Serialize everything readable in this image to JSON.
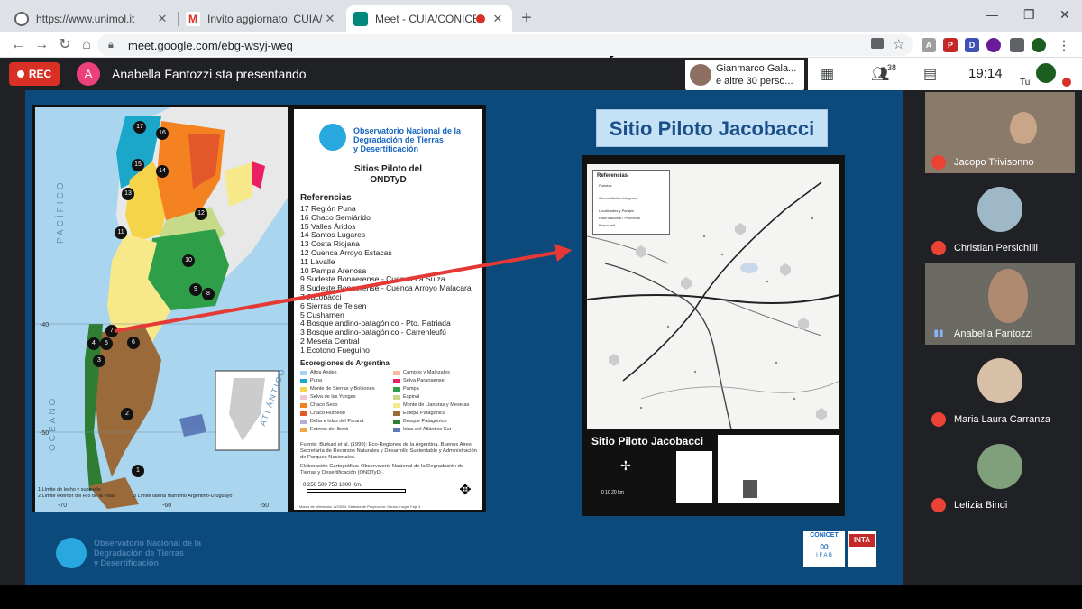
{
  "browser": {
    "tabs": [
      {
        "title": "https://www.unimol.it"
      },
      {
        "title": "Invito aggiornato: CUIA/CONICE"
      },
      {
        "title": "Meet - CUIA/CONICET: WEB"
      }
    ],
    "url": "meet.google.com/ebg-wsyj-weq"
  },
  "meet": {
    "rec_label": "REC",
    "presenter_initial": "A",
    "presenter_text": "Anabella Fantozzi sta presentando",
    "guest_line1": "Gianmarco Gala...",
    "guest_line2": "e altre 30 perso...",
    "participants_count": "38",
    "time": "19:14",
    "self_label": "Tu"
  },
  "slide": {
    "obs_title": [
      "Observatorio Nacional de la",
      "Degradación de Tierras",
      "y Desertificación"
    ],
    "sites_title": [
      "Sitios Piloto del",
      "ONDTyD"
    ],
    "references_title": "Referencias",
    "references": [
      "17 Región Puna",
      "16 Chaco Semiárido",
      "15 Valles Áridos",
      "14 Santos Lugares",
      "13 Costa Riojana",
      "12 Cuenca Arroyo Estacas",
      "11 Lavalle",
      "10 Pampa Arenosa",
      "9 Sudeste Bonaerense - Cuenca La Suiza",
      "8 Sudeste Bonaerense - Cuenca Arroyo Malacara",
      "7 Jacobacci",
      "6 Sierras de Telsen",
      "5 Cushamen",
      "4 Bosque andino-patagónico - Pto. Patriada",
      "3 Bosque andino-patagónico - Carrenleufú",
      "2 Meseta Central",
      "1 Ecotono Fueguino"
    ],
    "ecoregions_title": "Ecoregiones de Argentina",
    "ecoregions_left": [
      {
        "name": "Altos Andes",
        "color": "#9fd3ef"
      },
      {
        "name": "Puna",
        "color": "#1aa7c9"
      },
      {
        "name": "Monte de Sierras y Bolsones",
        "color": "#f5d44a"
      },
      {
        "name": "Selva de las Yungas",
        "color": "#f3c2d8"
      },
      {
        "name": "Chaco Seco",
        "color": "#f58220"
      },
      {
        "name": "Chaco Húmedo",
        "color": "#e2582a"
      },
      {
        "name": "Delta e Islas del Paraná",
        "color": "#b0b0d8"
      },
      {
        "name": "Esteros del Iberá",
        "color": "#f0a84a"
      }
    ],
    "ecoregions_right": [
      {
        "name": "Campos y Malezales",
        "color": "#f6b9a1"
      },
      {
        "name": "Selva Paranaense",
        "color": "#e91e63"
      },
      {
        "name": "Pampa",
        "color": "#2e9e48"
      },
      {
        "name": "Espinal",
        "color": "#c6da8a"
      },
      {
        "name": "Monte de Llanuras y Mesetas",
        "color": "#f7e98a"
      },
      {
        "name": "Estepa Patagónica",
        "color": "#9b6a3a"
      },
      {
        "name": "Bosque Patagónico",
        "color": "#2e7d32"
      },
      {
        "name": "Islas del Atlántico Sur",
        "color": "#5c7ab8"
      }
    ],
    "source": "Fuente: Burkart et al. (1999): Eco-Regiones de la Argentina. Buenos Aires, Secretaría de Recursos Naturales y Desarrollo Sustentable y Administración de Parques Nacionales.",
    "cartography": "Elaboración Cartográfica: Observatorio Nacional de la Degradación de Tierras y Desertificación (ONDTyD).",
    "scale_labels": "0    250    500    750    1000 Km.",
    "map_labels": {
      "pacifico": "PACÍFICO",
      "oceano": "OCEANO",
      "atlantico": "ATLÁNTICO",
      "lat40": "-40",
      "lat50": "-50",
      "lon70": "-70",
      "lon60": "-60",
      "lon50": "-50",
      "limit1": "1 Límite de lecho y subsuelo",
      "limit2": "2 Límite exterior del Río de la Plata",
      "limit3": "3 Límite lateral marítimo Argentino-Uruguayo"
    },
    "marco": "Marco de referencia: WGS84. Sistema de Proyección: Gauss-Kruger Faja 4",
    "pilot_title": "Sitio Piloto Jacobacci",
    "pilot_legend": {
      "title": "Referencias",
      "items": [
        "Puestos",
        "Comunidades Indígenas",
        "Localidades y Parajes",
        "Ruta Nacional / Provincial",
        "Ferrocarril"
      ]
    },
    "pilot_label": "Sitio Piloto Jacobacci",
    "pilot_scale": "0    10    20 km",
    "footer_title": [
      "Observatorio Nacional de la",
      "Degradación de Tierras",
      "y Desertificación"
    ],
    "logo_conicet": "CONICET",
    "logo_inta": "INTA",
    "logo_ifab": "I F A B"
  },
  "participants": [
    {
      "name": "Jacopo Trivisonno",
      "muted": true
    },
    {
      "name": "Christian Persichilli",
      "muted": true
    },
    {
      "name": "Anabella Fantozzi",
      "muted": false
    },
    {
      "name": "Maria Laura Carranza",
      "muted": true
    },
    {
      "name": "Letizia Bindi",
      "muted": true
    }
  ],
  "colors": {
    "slide_bg": "#0d4a7c",
    "rec": "#d93025",
    "arrow": "#e53935"
  }
}
